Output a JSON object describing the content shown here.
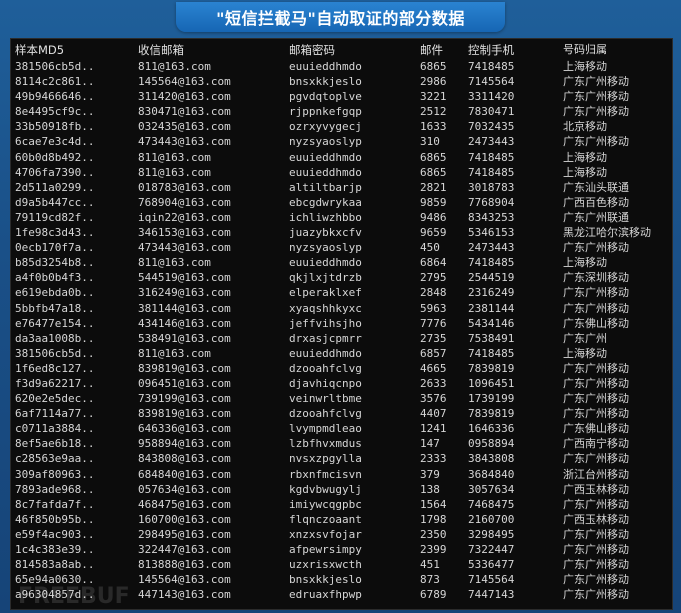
{
  "banner": {
    "title": "\"短信拦截马\"自动取证的部分数据"
  },
  "columns": [
    "样本MD5",
    "收信邮箱",
    "邮箱密码",
    "邮件",
    "控制手机",
    "号码归属"
  ],
  "rows": [
    {
      "md5": "381506cb5d..",
      "email": "811@163.com",
      "pwd": "euuieddhmdo",
      "mail": "6865",
      "phone": "7418485",
      "loc": "上海移动"
    },
    {
      "md5": "8114c2c861..",
      "email": "145564@163.com",
      "pwd": "bnsxkkjeslo",
      "mail": "2986",
      "phone": "7145564",
      "loc": "广东广州移动"
    },
    {
      "md5": "49b9466646..",
      "email": "311420@163.com",
      "pwd": "pgvdqtoplve",
      "mail": "3221",
      "phone": "3311420",
      "loc": "广东广州移动"
    },
    {
      "md5": "8e4495cf9c..",
      "email": "830471@163.com",
      "pwd": "rjppnkefgqp",
      "mail": "2512",
      "phone": "7830471",
      "loc": "广东广州移动"
    },
    {
      "md5": "33b50918fb..",
      "email": "032435@163.com",
      "pwd": "ozrxyvygecj",
      "mail": "1633",
      "phone": "7032435",
      "loc": "北京移动"
    },
    {
      "md5": "6cae7e3c4d..",
      "email": "473443@163.com",
      "pwd": "nyzsyaoslyp",
      "mail": "310",
      "phone": "2473443",
      "loc": "广东广州移动"
    },
    {
      "md5": "60b0d8b492..",
      "email": "811@163.com",
      "pwd": "euuieddhmdo",
      "mail": "6865",
      "phone": "7418485",
      "loc": "上海移动"
    },
    {
      "md5": "4706fa7390..",
      "email": "811@163.com",
      "pwd": "euuieddhmdo",
      "mail": "6865",
      "phone": "7418485",
      "loc": "上海移动"
    },
    {
      "md5": "2d511a0299..",
      "email": "018783@163.com",
      "pwd": "altiltbarjp",
      "mail": "2821",
      "phone": "3018783",
      "loc": "广东汕头联通"
    },
    {
      "md5": "d9a5b447cc..",
      "email": "768904@163.com",
      "pwd": "ebcgdwrykaa",
      "mail": "9859",
      "phone": "7768904",
      "loc": "广西百色移动"
    },
    {
      "md5": "79119cd82f..",
      "email": "iqin22@163.com",
      "pwd": "ichliwzhbbo",
      "mail": "9486",
      "phone": "8343253",
      "loc": "广东广州联通"
    },
    {
      "md5": "1fe98c3d43..",
      "email": "346153@163.com",
      "pwd": "juazybkxcfv",
      "mail": "9659",
      "phone": "5346153",
      "loc": "黑龙江哈尔滨移动"
    },
    {
      "md5": "0ecb170f7a..",
      "email": "473443@163.com",
      "pwd": "nyzsyaoslyp",
      "mail": "450",
      "phone": "2473443",
      "loc": "广东广州移动"
    },
    {
      "md5": "b85d3254b8..",
      "email": "811@163.com",
      "pwd": "euuieddhmdo",
      "mail": "6864",
      "phone": "7418485",
      "loc": "上海移动"
    },
    {
      "md5": "a4f0b0b4f3..",
      "email": "544519@163.com",
      "pwd": "qkjlxjtdrzb",
      "mail": "2795",
      "phone": "2544519",
      "loc": "广东深圳移动"
    },
    {
      "md5": "e619ebda0b..",
      "email": "316249@163.com",
      "pwd": "elperaklxef",
      "mail": "2848",
      "phone": "2316249",
      "loc": "广东广州移动"
    },
    {
      "md5": "5bbfb47a18..",
      "email": "381144@163.com",
      "pwd": "xyaqshhkyxc",
      "mail": "5963",
      "phone": "2381144",
      "loc": "广东广州移动"
    },
    {
      "md5": "e76477e154..",
      "email": "434146@163.com",
      "pwd": "jeffvihsjho",
      "mail": "7776",
      "phone": "5434146",
      "loc": "广东佛山移动"
    },
    {
      "md5": "da3aa1008b..",
      "email": "538491@163.com",
      "pwd": "drxasjcpmrr",
      "mail": "2735",
      "phone": "7538491",
      "loc": "广东广州"
    },
    {
      "md5": "381506cb5d..",
      "email": "811@163.com",
      "pwd": "euuieddhmdo",
      "mail": "6857",
      "phone": "7418485",
      "loc": "上海移动"
    },
    {
      "md5": "1f6ed8c127..",
      "email": "839819@163.com",
      "pwd": "dzooahfclvg",
      "mail": "4665",
      "phone": "7839819",
      "loc": "广东广州移动"
    },
    {
      "md5": "f3d9a62217..",
      "email": "096451@163.com",
      "pwd": "djavhiqcnpo",
      "mail": "2633",
      "phone": "1096451",
      "loc": "广东广州移动"
    },
    {
      "md5": "620e2e5dec..",
      "email": "739199@163.com",
      "pwd": "veinwrltbme",
      "mail": "3576",
      "phone": "1739199",
      "loc": "广东广州移动"
    },
    {
      "md5": "6af7114a77..",
      "email": "839819@163.com",
      "pwd": "dzooahfclvg",
      "mail": "4407",
      "phone": "7839819",
      "loc": "广东广州移动"
    },
    {
      "md5": "c0711a3884..",
      "email": "646336@163.com",
      "pwd": "lvympmdleao",
      "mail": "1241",
      "phone": "1646336",
      "loc": "广东佛山移动"
    },
    {
      "md5": "8ef5ae6b18..",
      "email": "958894@163.com",
      "pwd": "lzbfhvxmdus",
      "mail": "147",
      "phone": "0958894",
      "loc": "广西南宁移动"
    },
    {
      "md5": "c28563e9aa..",
      "email": "843808@163.com",
      "pwd": "nvsxzpgylla",
      "mail": "2333",
      "phone": "3843808",
      "loc": "广东广州移动"
    },
    {
      "md5": "309af80963..",
      "email": "684840@163.com",
      "pwd": "rbxnfmcisvn",
      "mail": "379",
      "phone": "3684840",
      "loc": "浙江台州移动"
    },
    {
      "md5": "7893ade968..",
      "email": "057634@163.com",
      "pwd": "kgdvbwugylj",
      "mail": "138",
      "phone": "3057634",
      "loc": "广西玉林移动"
    },
    {
      "md5": "8c7fafda7f..",
      "email": "468475@163.com",
      "pwd": "imiywcqgpbc",
      "mail": "1564",
      "phone": "7468475",
      "loc": "广东广州移动"
    },
    {
      "md5": "46f850b95b..",
      "email": "160700@163.com",
      "pwd": "flqnczoaant",
      "mail": "1798",
      "phone": "2160700",
      "loc": "广西玉林移动"
    },
    {
      "md5": "e59f4ac903..",
      "email": "298495@163.com",
      "pwd": "xnzxsvfojar",
      "mail": "2350",
      "phone": "3298495",
      "loc": "广东广州移动"
    },
    {
      "md5": "1c4c383e39..",
      "email": "322447@163.com",
      "pwd": "afpewrsimpy",
      "mail": "2399",
      "phone": "7322447",
      "loc": "广东广州移动"
    },
    {
      "md5": "814583a8ab..",
      "email": "813888@163.com",
      "pwd": "uzxrisxwcth",
      "mail": "451",
      "phone": "5336477",
      "loc": "广东广州移动"
    },
    {
      "md5": "65e94a0630..",
      "email": "145564@163.com",
      "pwd": "bnsxkkjeslo",
      "mail": "873",
      "phone": "7145564",
      "loc": "广东广州移动"
    },
    {
      "md5": "a96304857d..",
      "email": "447143@163.com",
      "pwd": "edruaxfhpwp",
      "mail": "6789",
      "phone": "7447143",
      "loc": "广东广州移动"
    }
  ]
}
